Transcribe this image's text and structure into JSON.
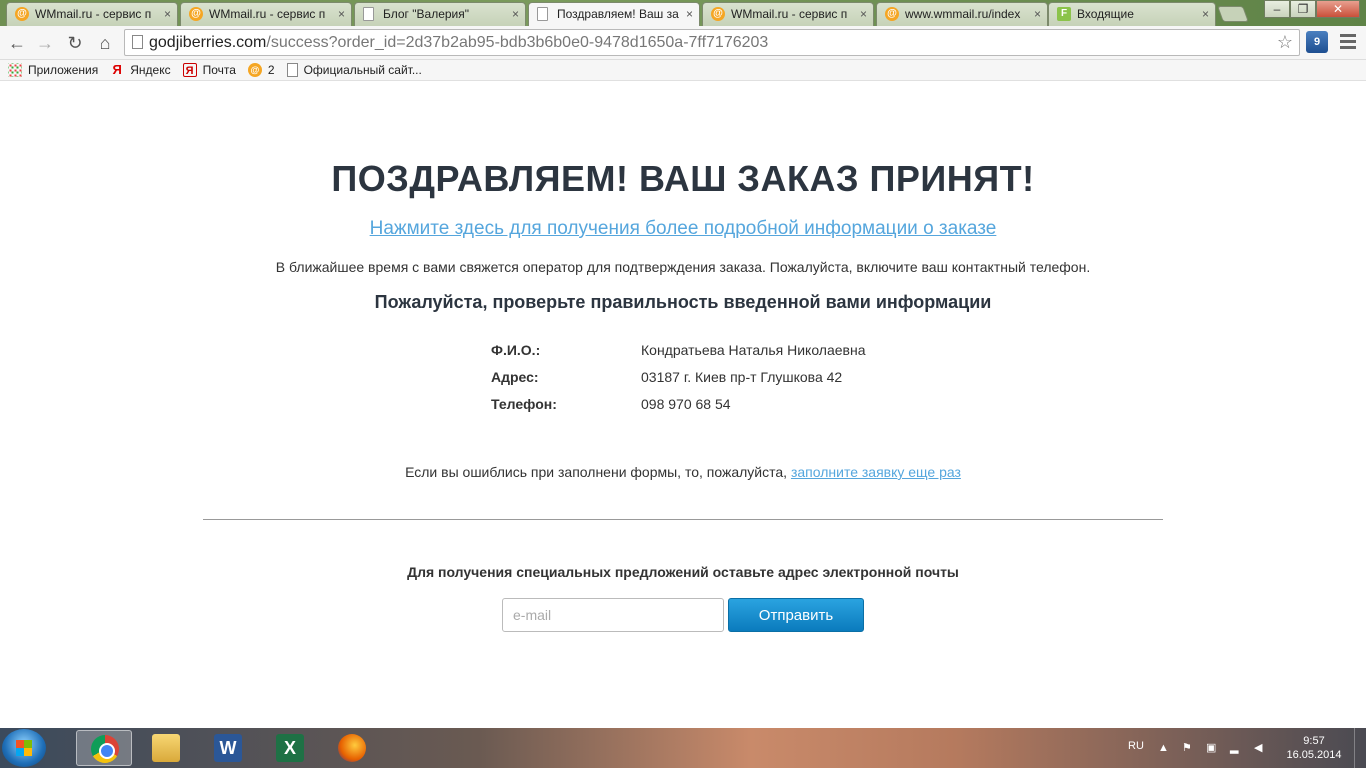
{
  "browser": {
    "tabs": [
      {
        "title": "WMmail.ru - сервис п",
        "icon": "at-icon",
        "active": false
      },
      {
        "title": "WMmail.ru - сервис п",
        "icon": "at-icon",
        "active": false
      },
      {
        "title": "Блог \"Валерия\"",
        "icon": "doc-icon",
        "active": false
      },
      {
        "title": "Поздравляем! Ваш за",
        "icon": "doc-icon",
        "active": true
      },
      {
        "title": "WMmail.ru - сервис п",
        "icon": "at-icon",
        "active": false
      },
      {
        "title": "www.wmmail.ru/index",
        "icon": "at-icon",
        "active": false
      },
      {
        "title": "Входящие",
        "icon": "f-icon",
        "active": false
      }
    ],
    "url_host": "godjiberries.com",
    "url_path": "/success?order_id=2d37b2ab95-bdb3b6b0e0-9478d1650a-7ff7176203",
    "ext_badge": "9",
    "bookmarks": [
      {
        "label": "Приложения",
        "icon": "apps-grid-icon"
      },
      {
        "label": "Яндекс",
        "icon": "yandex-icon"
      },
      {
        "label": "Почта",
        "icon": "mail-icon"
      },
      {
        "label": "2",
        "icon": "at-icon"
      },
      {
        "label": "Официальный сайт...",
        "icon": "doc-icon"
      }
    ]
  },
  "page": {
    "title": "ПОЗДРАВЛЯЕМ! ВАШ ЗАКАЗ ПРИНЯТ!",
    "details_link": "Нажмите здесь для получения более подробной информации о заказе",
    "notice": "В ближайшее время с вами свяжется оператор для подтверждения заказа. Пожалуйста, включите ваш контактный телефон.",
    "check_title": "Пожалуйста, проверьте правильность введенной вами информации",
    "info": [
      {
        "label": "Ф.И.О.:",
        "value": "Кондратьева Наталья Николаевна"
      },
      {
        "label": "Адрес:",
        "value": "03187 г. Киев пр-т Глушкова 42"
      },
      {
        "label": "Телефон:",
        "value": "098 970 68 54"
      }
    ],
    "mistake_text": "Если вы ошиблись при заполнени формы, то, пожалуйста,",
    "mistake_link": "заполните заявку еще раз",
    "promo": "Для получения специальных предложений оставьте адрес электронной почты",
    "email_placeholder": "e-mail",
    "send_label": "Отправить"
  },
  "taskbar": {
    "apps": [
      "chrome-icon",
      "explorer-folder-icon",
      "word-icon",
      "excel-icon",
      "firefox-icon"
    ],
    "lang": "RU",
    "time": "9:57",
    "date": "16.05.2014"
  },
  "colors": {
    "link": "#55a6dd",
    "title": "#2c3540",
    "button": "#0b7bbd"
  }
}
